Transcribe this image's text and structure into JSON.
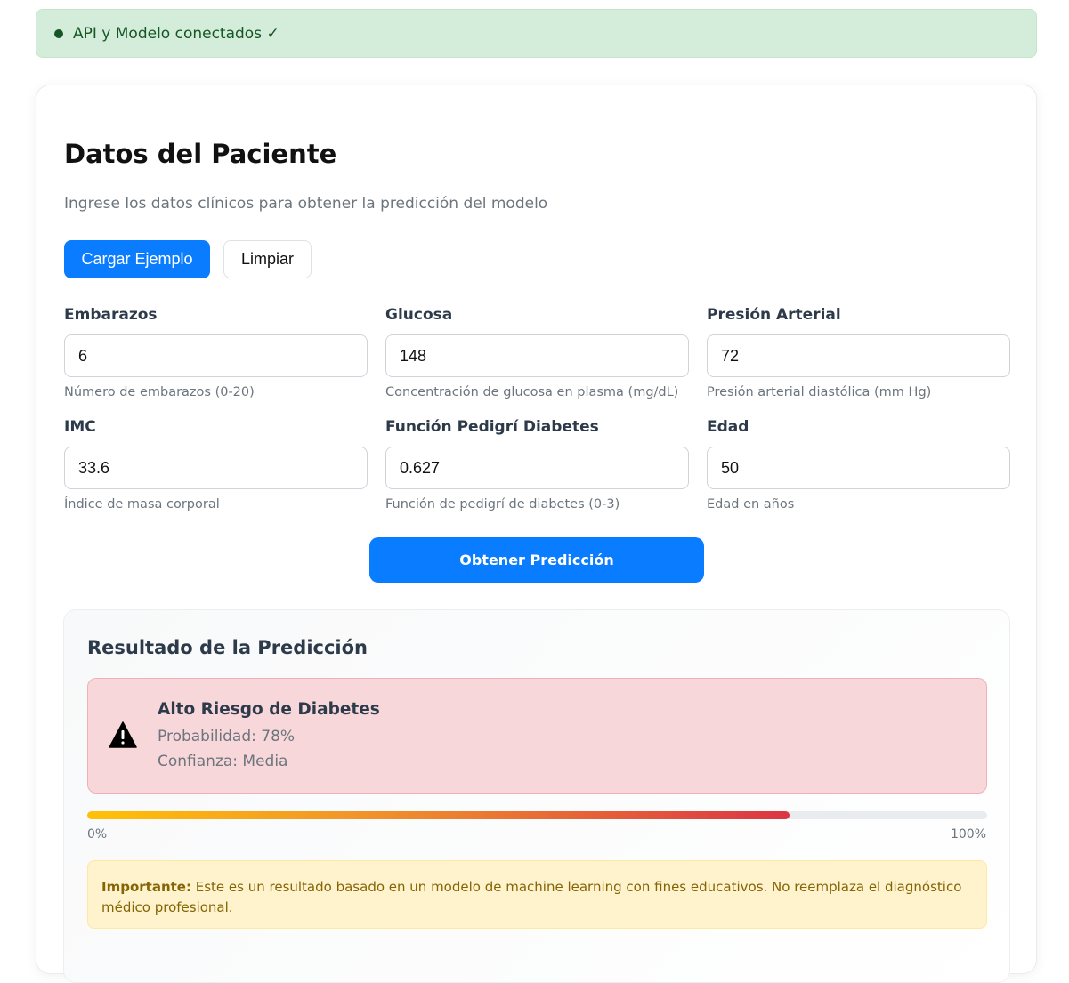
{
  "status": {
    "text": "API y Modelo conectados ✓",
    "color": "#155724",
    "background": "#d4edda"
  },
  "form": {
    "title": "Datos del Paciente",
    "subtitle": "Ingrese los datos clínicos para obtener la predicción del modelo",
    "load_example_label": "Cargar Ejemplo",
    "clear_label": "Limpiar",
    "fields": [
      {
        "label": "Embarazos",
        "value": "6",
        "help": "Número de embarazos (0-20)"
      },
      {
        "label": "Glucosa",
        "value": "148",
        "help": "Concentración de glucosa en plasma (mg/dL)"
      },
      {
        "label": "Presión Arterial",
        "value": "72",
        "help": "Presión arterial diastólica (mm Hg)"
      },
      {
        "label": "IMC",
        "value": "33.6",
        "help": "Índice de masa corporal"
      },
      {
        "label": "Función Pedigrí Diabetes",
        "value": "0.627",
        "help": "Función de pedigrí de diabetes (0-3)"
      },
      {
        "label": "Edad",
        "value": "50",
        "help": "Edad en años"
      }
    ],
    "predict_label": "Obtener Predicción",
    "accent_color": "#0a7cff"
  },
  "result": {
    "title": "Resultado de la Predicción",
    "alert_icon": "warning-triangle-icon",
    "alert_title": "Alto Riesgo de Diabetes",
    "probability_text": "Probabilidad: 78%",
    "confidence_text": "Confianza: Media",
    "probability_fraction": 0.78,
    "scale_min": "0%",
    "scale_max": "100%",
    "note_bold": "Importante:",
    "note_text": " Este es un resultado basado en un modelo de machine learning con fines educativos. No reemplaza el diagnóstico médico profesional.",
    "alert_color": "#f8d7da",
    "note_color": "#fff3cd"
  }
}
